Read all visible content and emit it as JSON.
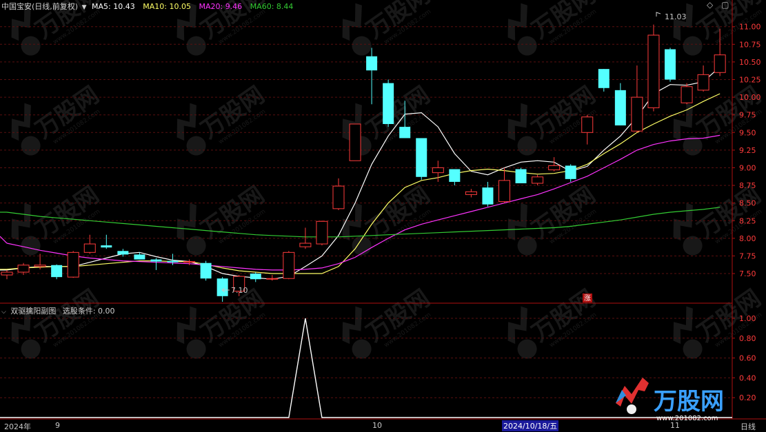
{
  "header": {
    "stock": "中国宝安(日线,前复权)",
    "ma5_label": "MA5:",
    "ma5_value": "10.43",
    "ma10_label": "MA10:",
    "ma10_value": "10.05",
    "ma20_label": "MA20:",
    "ma20_value": "9.46",
    "ma60_label": "MA60:",
    "ma60_value": "8.44"
  },
  "sub_header": {
    "indicator": "双驱擒阳副图",
    "condition_label": "选股条件:",
    "condition_value": "0.00"
  },
  "annotations": {
    "high": "11.03",
    "low": "7.10",
    "limit_up": "涨"
  },
  "time_axis": {
    "year_label": "2024年",
    "month_9": "9",
    "month_10": "10",
    "month_11": "11",
    "crosshair_date": "2024/10/18/五",
    "period": "日线"
  },
  "watermark": {
    "brand": "万股网",
    "url": "www.201082.com"
  },
  "colors": {
    "up": "#ff3b3b",
    "down": "#54ffff",
    "ma5": "#ffffff",
    "ma10": "#ffff66",
    "ma20": "#ff33ff",
    "ma60": "#33cc33",
    "axis": "#b01010",
    "grid": "#5a0f0f"
  },
  "chart_data": [
    {
      "type": "candlestick",
      "title": "中国宝安(日线,前复权)",
      "y_ticks": [
        11.0,
        10.75,
        10.5,
        10.25,
        10.0,
        9.75,
        9.5,
        9.25,
        9.0,
        8.75,
        8.5,
        8.25,
        8.0,
        7.75,
        7.5
      ],
      "ylim": [
        7.1,
        11.3
      ],
      "grid": true,
      "candles": [
        {
          "o": 7.48,
          "h": 7.55,
          "l": 7.42,
          "c": 7.52
        },
        {
          "o": 7.52,
          "h": 7.65,
          "l": 7.48,
          "c": 7.62
        },
        {
          "o": 7.6,
          "h": 7.78,
          "l": 7.56,
          "c": 7.62
        },
        {
          "o": 7.62,
          "h": 7.63,
          "l": 7.42,
          "c": 7.45
        },
        {
          "o": 7.45,
          "h": 7.82,
          "l": 7.44,
          "c": 7.8
        },
        {
          "o": 7.8,
          "h": 8.05,
          "l": 7.78,
          "c": 7.92
        },
        {
          "o": 7.9,
          "h": 8.05,
          "l": 7.85,
          "c": 7.87
        },
        {
          "o": 7.82,
          "h": 7.85,
          "l": 7.74,
          "c": 7.77
        },
        {
          "o": 7.77,
          "h": 7.8,
          "l": 7.7,
          "c": 7.7
        },
        {
          "o": 7.7,
          "h": 7.72,
          "l": 7.55,
          "c": 7.67
        },
        {
          "o": 7.68,
          "h": 7.78,
          "l": 7.62,
          "c": 7.66
        },
        {
          "o": 7.66,
          "h": 7.7,
          "l": 7.62,
          "c": 7.67
        },
        {
          "o": 7.65,
          "h": 7.68,
          "l": 7.4,
          "c": 7.43
        },
        {
          "o": 7.43,
          "h": 7.45,
          "l": 7.1,
          "c": 7.18
        },
        {
          "o": 7.25,
          "h": 7.48,
          "l": 7.18,
          "c": 7.46
        },
        {
          "o": 7.5,
          "h": 7.52,
          "l": 7.38,
          "c": 7.42
        },
        {
          "o": 7.42,
          "h": 7.48,
          "l": 7.4,
          "c": 7.43
        },
        {
          "o": 7.43,
          "h": 7.82,
          "l": 7.42,
          "c": 7.8
        },
        {
          "o": 7.88,
          "h": 8.15,
          "l": 7.85,
          "c": 7.93
        },
        {
          "o": 7.92,
          "h": 8.25,
          "l": 7.9,
          "c": 8.24
        },
        {
          "o": 8.42,
          "h": 8.85,
          "l": 8.4,
          "c": 8.74
        },
        {
          "o": 9.1,
          "h": 9.62,
          "l": 9.1,
          "c": 9.62
        },
        {
          "o": 10.58,
          "h": 10.7,
          "l": 9.9,
          "c": 10.38
        },
        {
          "o": 10.2,
          "h": 10.25,
          "l": 9.58,
          "c": 9.62
        },
        {
          "o": 9.58,
          "h": 9.95,
          "l": 9.42,
          "c": 9.42
        },
        {
          "o": 9.42,
          "h": 9.42,
          "l": 8.83,
          "c": 8.87
        },
        {
          "o": 8.93,
          "h": 9.1,
          "l": 8.8,
          "c": 9.0
        },
        {
          "o": 8.98,
          "h": 8.98,
          "l": 8.75,
          "c": 8.8
        },
        {
          "o": 8.62,
          "h": 8.7,
          "l": 8.58,
          "c": 8.66
        },
        {
          "o": 8.72,
          "h": 8.8,
          "l": 8.45,
          "c": 8.48
        },
        {
          "o": 8.52,
          "h": 9.0,
          "l": 8.5,
          "c": 8.82
        },
        {
          "o": 8.98,
          "h": 9.0,
          "l": 8.78,
          "c": 8.78
        },
        {
          "o": 8.78,
          "h": 8.9,
          "l": 8.75,
          "c": 8.87
        },
        {
          "o": 8.97,
          "h": 9.15,
          "l": 8.95,
          "c": 9.03
        },
        {
          "o": 9.03,
          "h": 9.05,
          "l": 8.8,
          "c": 8.84
        },
        {
          "o": 9.5,
          "h": 9.75,
          "l": 9.33,
          "c": 9.72
        },
        {
          "o": 10.4,
          "h": 10.4,
          "l": 10.08,
          "c": 10.13
        },
        {
          "o": 10.1,
          "h": 10.2,
          "l": 9.6,
          "c": 9.6
        },
        {
          "o": 9.52,
          "h": 10.45,
          "l": 9.5,
          "c": 10.0
        },
        {
          "o": 9.85,
          "h": 11.03,
          "l": 9.8,
          "c": 10.88
        },
        {
          "o": 10.68,
          "h": 10.7,
          "l": 10.22,
          "c": 10.25
        },
        {
          "o": 9.92,
          "h": 10.2,
          "l": 9.9,
          "c": 10.15
        },
        {
          "o": 10.1,
          "h": 10.45,
          "l": 10.08,
          "c": 10.32
        },
        {
          "o": 10.35,
          "h": 10.97,
          "l": 10.3,
          "c": 10.6
        }
      ],
      "series": [
        {
          "name": "MA5",
          "values": [
            7.55,
            7.58,
            7.6,
            7.6,
            7.6,
            7.66,
            7.72,
            7.78,
            7.8,
            7.74,
            7.69,
            7.67,
            7.6,
            7.5,
            7.46,
            7.44,
            7.42,
            7.46,
            7.6,
            7.75,
            8.04,
            8.5,
            9.05,
            9.45,
            9.76,
            9.78,
            9.58,
            9.2,
            8.95,
            8.9,
            9.0,
            9.08,
            9.1,
            9.08,
            8.95,
            9.02,
            9.25,
            9.45,
            9.72,
            10.05,
            10.18,
            10.17,
            10.22,
            10.43
          ]
        },
        {
          "name": "MA10",
          "values": [
            7.56,
            7.58,
            7.59,
            7.6,
            7.6,
            7.62,
            7.64,
            7.66,
            7.68,
            7.68,
            7.67,
            7.67,
            7.63,
            7.58,
            7.54,
            7.52,
            7.5,
            7.5,
            7.5,
            7.5,
            7.6,
            7.85,
            8.2,
            8.5,
            8.72,
            8.82,
            8.86,
            8.92,
            8.96,
            8.98,
            8.96,
            8.93,
            8.91,
            8.92,
            8.96,
            9.05,
            9.2,
            9.34,
            9.5,
            9.62,
            9.73,
            9.82,
            9.94,
            10.05
          ]
        },
        {
          "name": "MA20",
          "values": [
            7.93,
            7.88,
            7.83,
            7.79,
            7.75,
            7.72,
            7.7,
            7.68,
            7.67,
            7.66,
            7.65,
            7.64,
            7.62,
            7.6,
            7.58,
            7.56,
            7.55,
            7.55,
            7.56,
            7.58,
            7.64,
            7.73,
            7.87,
            8.0,
            8.12,
            8.2,
            8.26,
            8.32,
            8.38,
            8.44,
            8.5,
            8.56,
            8.62,
            8.7,
            8.79,
            8.88,
            9.0,
            9.12,
            9.25,
            9.33,
            9.38,
            9.41,
            9.42,
            9.46
          ]
        },
        {
          "name": "MA60",
          "values": [
            8.37,
            8.34,
            8.31,
            8.29,
            8.27,
            8.25,
            8.23,
            8.21,
            8.19,
            8.17,
            8.15,
            8.13,
            8.11,
            8.09,
            8.07,
            8.05,
            8.04,
            8.03,
            8.02,
            8.02,
            8.02,
            8.03,
            8.04,
            8.05,
            8.06,
            8.07,
            8.08,
            8.09,
            8.1,
            8.11,
            8.12,
            8.13,
            8.14,
            8.15,
            8.17,
            8.2,
            8.23,
            8.26,
            8.3,
            8.34,
            8.37,
            8.39,
            8.41,
            8.44
          ]
        }
      ]
    },
    {
      "type": "line",
      "title": "双驱擒阳副图",
      "y_ticks": [
        1.0,
        0.8,
        0.6,
        0.4,
        0.2
      ],
      "ylim": [
        0,
        1.0
      ],
      "series": [
        {
          "name": "选股条件",
          "values": [
            0,
            0,
            0,
            0,
            0,
            0,
            0,
            0,
            0,
            0,
            0,
            0,
            0,
            0,
            0,
            0,
            0,
            0,
            1,
            0,
            0,
            0,
            0,
            0,
            0,
            0,
            0,
            0,
            0,
            0,
            0,
            0,
            0,
            0,
            0,
            0,
            0,
            0,
            0,
            0,
            0,
            0,
            0,
            0
          ]
        }
      ]
    }
  ]
}
